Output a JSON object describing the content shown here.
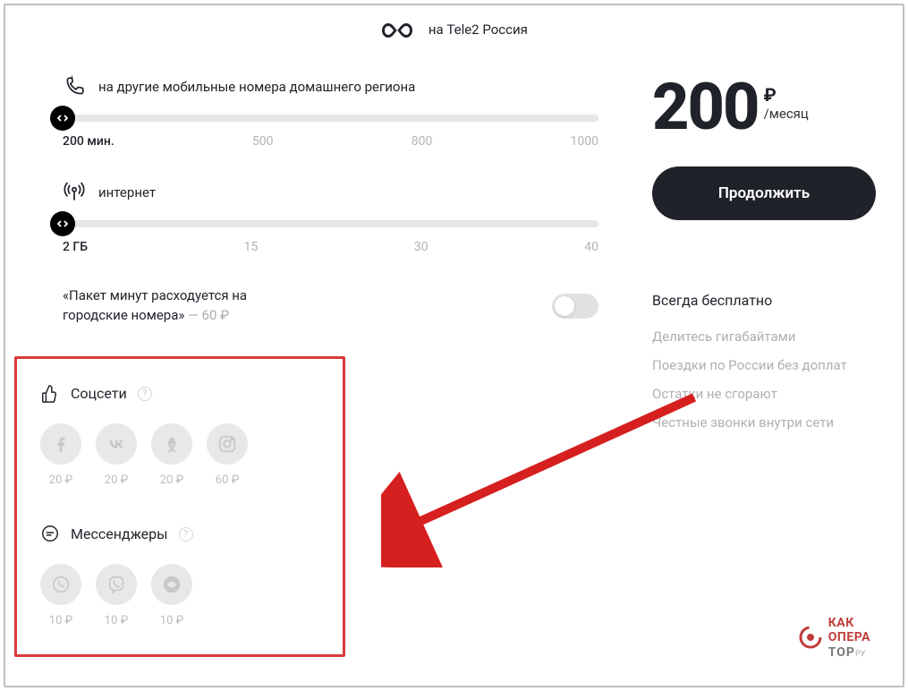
{
  "header": {
    "text": "на Tele2 Россия"
  },
  "sliders": {
    "minutes": {
      "label": "на другие мобильные номера домашнего региона",
      "ticks": [
        "200 мин.",
        "500",
        "800",
        "1000"
      ],
      "active_index": 0
    },
    "internet": {
      "label": "интернет",
      "ticks": [
        "2 ГБ",
        "15",
        "30",
        "40"
      ],
      "active_index": 0
    }
  },
  "city_option": {
    "text": "«Пакет минут расходуется на городские номера»",
    "price": " — 60 ₽"
  },
  "addons": {
    "social": {
      "title": "Соцсети",
      "items": [
        {
          "name": "facebook",
          "price": "20 ₽"
        },
        {
          "name": "vk",
          "price": "20 ₽"
        },
        {
          "name": "ok",
          "price": "20 ₽"
        },
        {
          "name": "instagram",
          "price": "60 ₽"
        }
      ]
    },
    "messengers": {
      "title": "Мессенджеры",
      "items": [
        {
          "name": "whatsapp",
          "price": "10 ₽"
        },
        {
          "name": "viber",
          "price": "10 ₽"
        },
        {
          "name": "tamtam",
          "price": "10 ₽"
        }
      ]
    }
  },
  "summary": {
    "price": "200",
    "currency": "₽",
    "period": "/месяц",
    "cta": "Продолжить",
    "free_title": "Всегда бесплатно",
    "free_items": [
      "Делитесь гигабайтами",
      "Поездки по России без доплат",
      "Остатки не сгорают",
      "Честные звонки внутри сети"
    ]
  },
  "watermark": {
    "l1": "КАК",
    "l2": "ОПЕРА",
    "l3": "ТОР",
    "ru": "РУ"
  }
}
